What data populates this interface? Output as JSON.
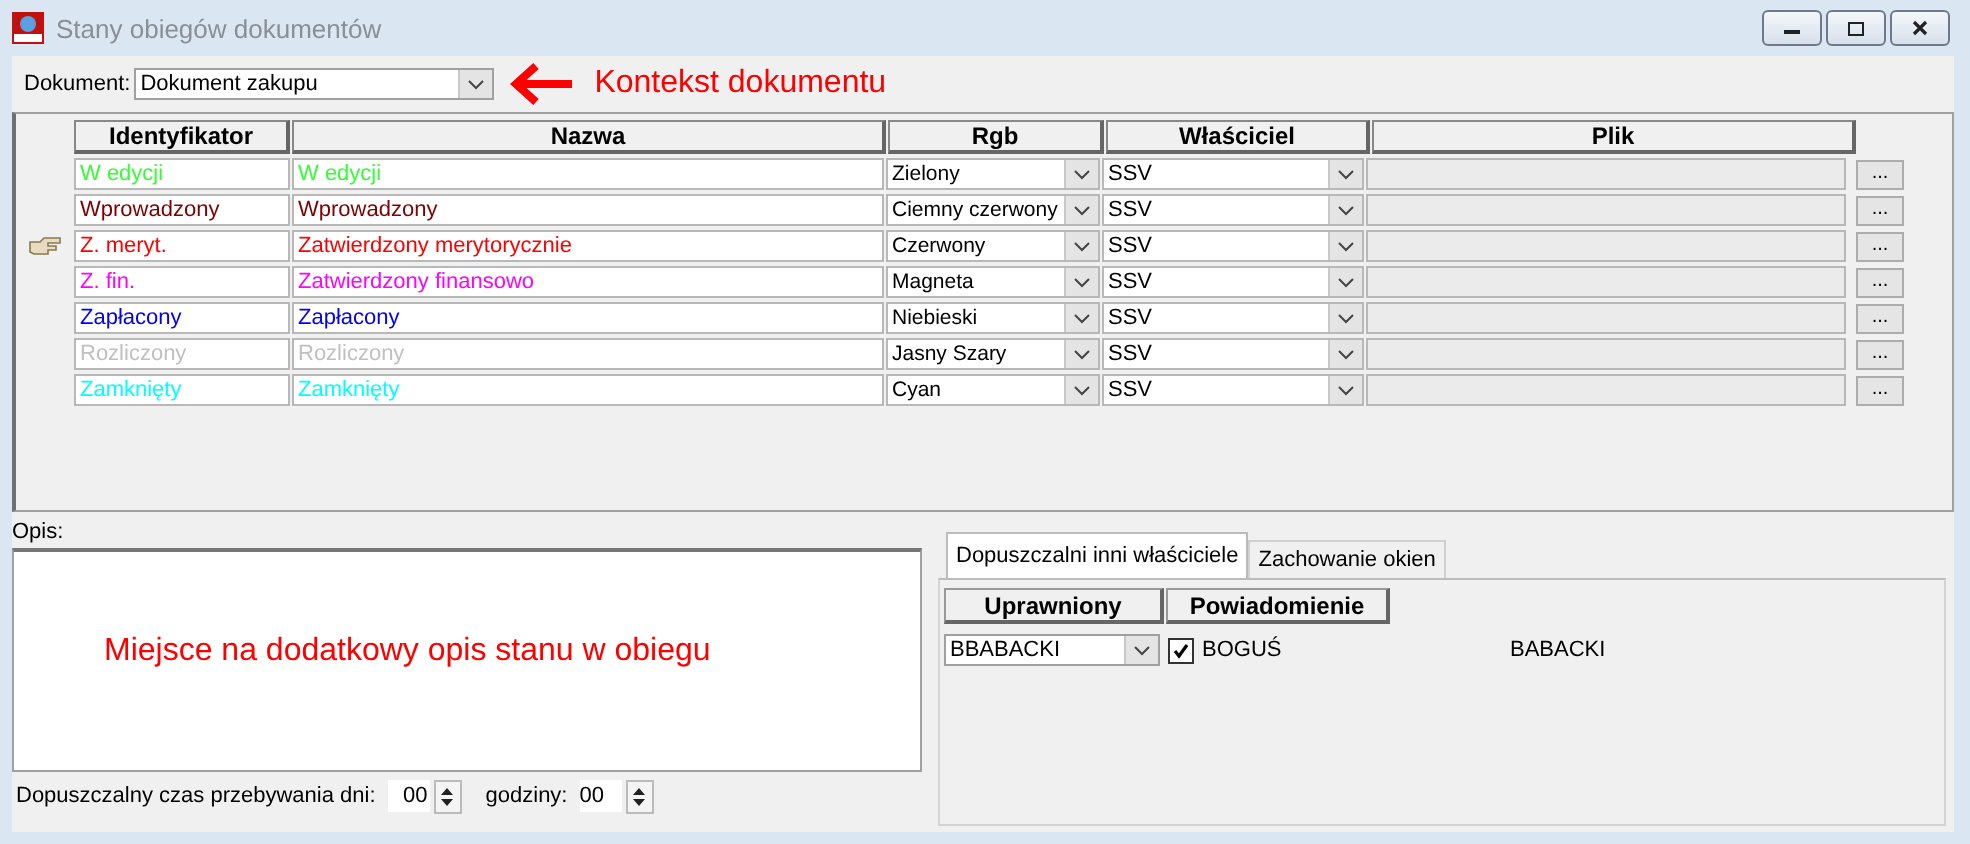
{
  "window": {
    "title": "Stany obiegów dokumentów"
  },
  "document": {
    "label": "Dokument:",
    "value": "Dokument zakupu",
    "annotation": "Kontekst dokumentu"
  },
  "table": {
    "columns": [
      "Identyfikator",
      "Nazwa",
      "Rgb",
      "Właściciel",
      "Plik"
    ],
    "rows": [
      {
        "id": "W edycji",
        "name": "W edycji",
        "rgb": "Zielony",
        "owner": "SSV",
        "button": "...",
        "color": "#33ff33",
        "selected": false
      },
      {
        "id": "Wprowadzony",
        "name": "Wprowadzony",
        "rgb": "Ciemny czerwony",
        "owner": "SSV",
        "button": "...",
        "color": "#800000",
        "selected": false
      },
      {
        "id": "Z. meryt.",
        "name": "Zatwierdzony merytorycznie",
        "rgb": "Czerwony",
        "owner": "SSV",
        "button": "...",
        "color": "#ff0000",
        "selected": true
      },
      {
        "id": "Z. fin.",
        "name": "Zatwierdzony finansowo",
        "rgb": "Magneta",
        "owner": "SSV",
        "button": "...",
        "color": "#ff00ff",
        "selected": false
      },
      {
        "id": "Zapłacony",
        "name": "Zapłacony",
        "rgb": "Niebieski",
        "owner": "SSV",
        "button": "...",
        "color": "#0000ff",
        "selected": false
      },
      {
        "id": "Rozliczony",
        "name": "Rozliczony",
        "rgb": "Jasny Szary",
        "owner": "SSV",
        "button": "...",
        "color": "#c0c0c0",
        "selected": false
      },
      {
        "id": "Zamknięty",
        "name": "Zamknięty",
        "rgb": "Cyan",
        "owner": "SSV",
        "button": "...",
        "color": "#00ffff",
        "selected": false
      }
    ]
  },
  "description": {
    "label": "Opis:",
    "text": "Miejsce na dodatkowy opis stanu w obiegu"
  },
  "duration": {
    "days_label": "Dopuszczalny czas przebywania dni:",
    "days": "00",
    "hours_label": "godziny:",
    "hours": "00"
  },
  "tabs": [
    {
      "label": "Dopuszczalni inni właściciele",
      "selected": true
    },
    {
      "label": "Zachowanie okien",
      "selected": false
    }
  ],
  "owners": {
    "columns": [
      "Uprawniony",
      "Powiadomienie"
    ],
    "rows": [
      {
        "user": "BBABACKI",
        "checked": true,
        "notify": "BOGUŚ",
        "column_3": "BABACKI"
      }
    ]
  }
}
